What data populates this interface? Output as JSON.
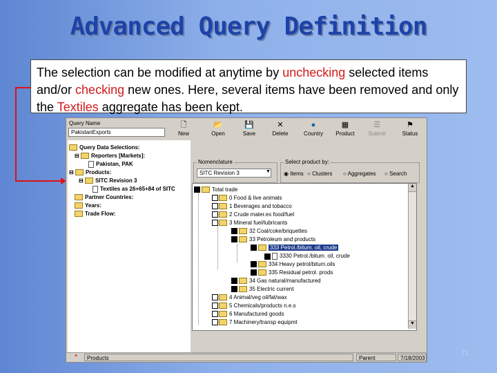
{
  "slide": {
    "title": "Advanced Query Definition",
    "callout": {
      "p1": "The selection can be modified at anytime by ",
      "h1": "unchecking",
      "p2": " selected items and/or ",
      "h2": "checking",
      "p3": " new ones. Here, several items have been removed and only the ",
      "h3": "Textiles",
      "p4": " aggregate has been kept."
    },
    "page_number": "71"
  },
  "app": {
    "query_name_label": "Query Name",
    "query_name_value": "PakistanExports",
    "toolbar": [
      "New",
      "Open",
      "Save",
      "Delete",
      "Country",
      "Product",
      "Submit",
      "Status"
    ],
    "toolbar_icons": [
      "new-icon",
      "open-icon",
      "save-icon",
      "delete-icon",
      "globe-icon",
      "product-icon",
      "submit-icon",
      "status-icon"
    ],
    "left_tree": {
      "root": "Query Data Selections:",
      "reporters": "Reporters [Markets]:",
      "pakistan": "Pakistan, PAK",
      "products": "Products:",
      "sitc": "SITC Revision 3",
      "textiles": "Textiles as 26+65+84 of SITC",
      "partner": "Partner Countries:",
      "years": "Years:",
      "tradeflow": "Trade Flow:"
    },
    "nomenclature": {
      "label": "Nomenclature",
      "value": "SITC Revision 3"
    },
    "select_by": {
      "label": "Select product by:",
      "options": [
        "Items",
        "Clusters",
        "Aggregates",
        "Search"
      ],
      "selected": "Items"
    },
    "product_tree": {
      "root": "Total trade",
      "items": [
        "0  Food & live animals",
        "1  Beverages and tobacco",
        "2  Crude mater.ex food/fuel",
        "3  Mineral fuel/lubricants",
        "32  Coal/coke/briquettes",
        "33  Petroleum and products",
        "333  Petrol./bitum. oil, crude",
        "3330  Petrol./bitum. oil, crude",
        "334  Heavy petrol/bitum.oils",
        "335  Residual petrol. prods",
        "34  Gas natural/manufactured",
        "35  Electric current",
        "4  Animal/veg oil/fat/wax",
        "5  Chemicals/products n.e.s",
        "6  Manufactured goods",
        "7  Machinery/transp equipmt"
      ]
    },
    "status": {
      "mark": "*",
      "left": "Products",
      "user": "Parent",
      "date": "7/18/2003"
    }
  },
  "colors": {
    "title": "#1d43a8",
    "highlight": "#d21a1a",
    "connector": "#e01010"
  }
}
